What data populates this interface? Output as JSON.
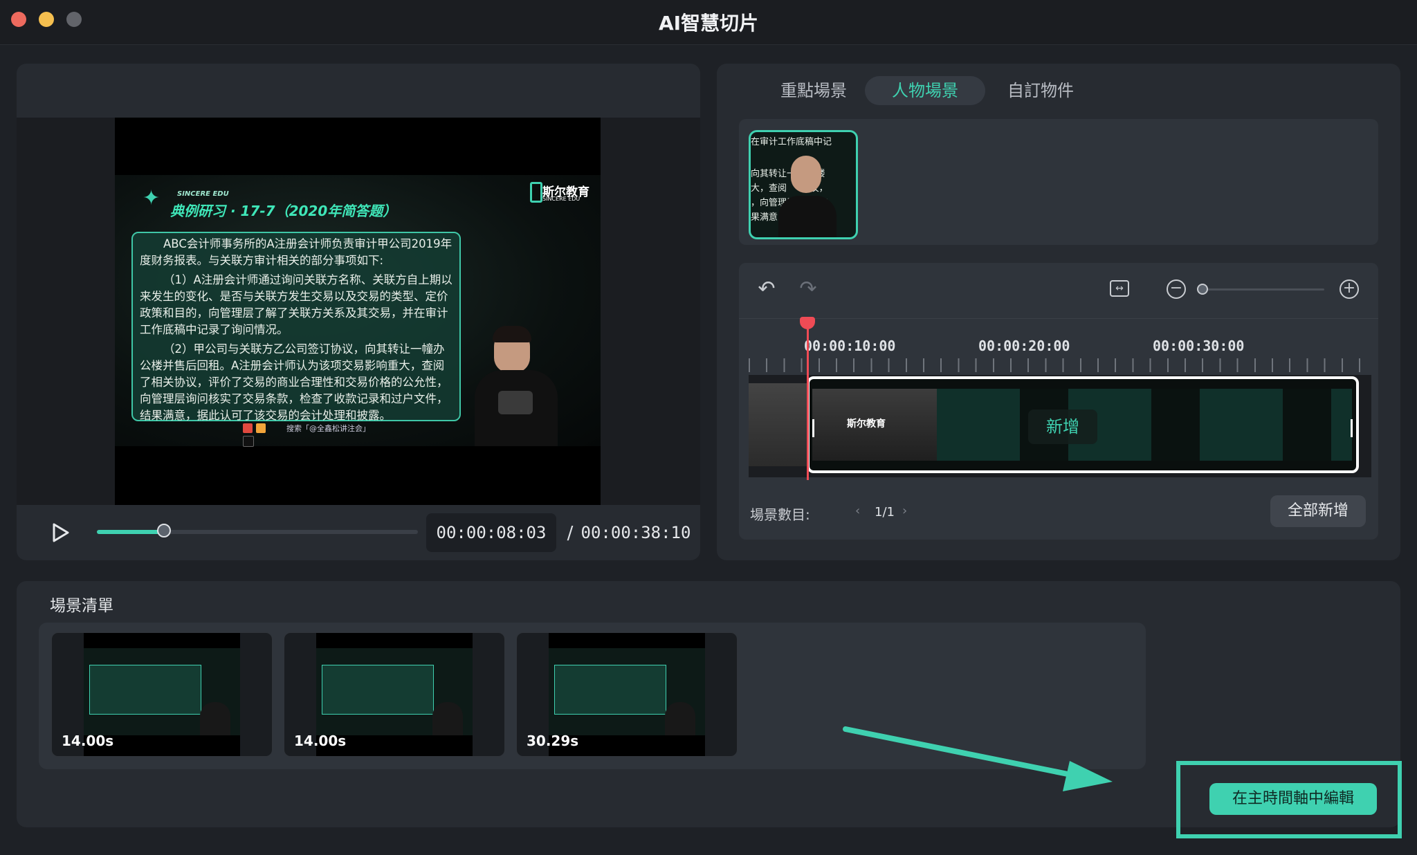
{
  "window": {
    "title": "AI智慧切片",
    "lights": [
      "#ed6a5e",
      "#f5bf4f",
      "#62646a"
    ]
  },
  "preview": {
    "slide": {
      "brand_small": "SINCERE EDU",
      "heading": "典例研习 · 17-7（2020年简答题）",
      "logo_text": "斯尔教育",
      "logo_sub": "SINCERE EDU",
      "paragraph1": "ABC会计师事务所的A注册会计师负责审计甲公司2019年度财务报表。与关联方审计相关的部分事项如下:",
      "paragraph2": "（1）A注册会计师通过询问关联方名称、关联方自上期以来发生的变化、是否与关联方发生交易以及交易的类型、定价政策和目的，向管理层了解了关联方关系及其交易，并在审计工作底稿中记录了询问情况。",
      "paragraph3": "（2）甲公司与关联方乙公司签订协议，向其转让一幢办公楼并售后回租。A注册会计师认为该项交易影响重大，查阅了相关协议，评价了交易的商业合理性和交易价格的公允性，向管理层询问核实了交易条款，检查了收款记录和过户文件，结果满意，据此认可了该交易的会计处理和披露。",
      "footer": "搜索「@全鑫松讲注会」"
    },
    "progress": 0.21,
    "current_time": "00:00:08:03",
    "separator": "/",
    "total_time": "00:00:38:10"
  },
  "tabs": [
    {
      "label": "重點場景"
    },
    {
      "label": "人物場景"
    },
    {
      "label": "自訂物件"
    }
  ],
  "scene_thumb": {
    "lines": [
      "在审计工作底稿中记",
      "向其转让一    公楼",
      "大，查阅     协议，",
      "，向管理层     核实",
      "果满意"
    ]
  },
  "timeline": {
    "ticks": [
      "00:00:10:00",
      "00:00:20:00",
      "00:00:30:00"
    ],
    "zoom": 0,
    "add_overlay": "新增",
    "scene_count_label": "場景數目:",
    "scene_count_value": "1/1",
    "add_all_label": "全部新增"
  },
  "scene_list": {
    "title": "場景清單",
    "items": [
      {
        "duration": "14.00s"
      },
      {
        "duration": "14.00s"
      },
      {
        "duration": "30.29s"
      }
    ]
  },
  "edit_button": "在主時間軸中編輯",
  "colors": {
    "accent": "#3fd1b0",
    "playhead": "#ef4b55",
    "background": "#1e2126",
    "panel": "#272b31"
  }
}
